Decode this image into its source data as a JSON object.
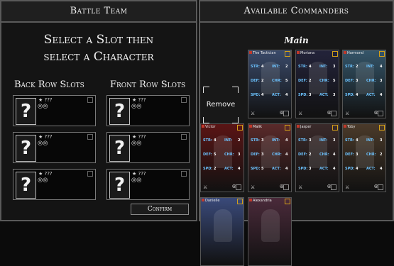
{
  "battle_team": {
    "title": "Battle Team",
    "instruction_line1": "Select a Slot then",
    "instruction_line2": "select a Character",
    "back_row_label": "Back Row Slots",
    "front_row_label": "Front Row Slots",
    "slot_placeholder": "?",
    "slot_stars": "★ ???",
    "slot_rank_icon": "three-circles-icon",
    "confirm_label": "Confirm"
  },
  "commanders": {
    "title": "Available Commanders",
    "section": "Main",
    "remove_label": "Remove",
    "cards": [
      {
        "name": "The Tactician",
        "color": "#3a4a6a",
        "str": "4",
        "int": "2",
        "def": "2",
        "chr": "5",
        "spd": "4",
        "act": "4"
      },
      {
        "name": "Moriana",
        "color": "#23233a",
        "str": "4",
        "int": "3",
        "def": "2",
        "chr": "5",
        "spd": "3",
        "act": "3"
      },
      {
        "name": "Harmond",
        "color": "#35566a",
        "str": "2",
        "int": "4",
        "def": "3",
        "chr": "3",
        "spd": "4",
        "act": "4"
      },
      {
        "name": "Victor",
        "color": "#5a1515",
        "str": "4",
        "int": "2",
        "def": "5",
        "chr": "3",
        "spd": "2",
        "act": "4"
      },
      {
        "name": "Malik",
        "color": "#5a2a2a",
        "str": "3",
        "int": "4",
        "def": "3",
        "chr": "4",
        "spd": "5",
        "act": "4"
      },
      {
        "name": "Jasper",
        "color": "#3a2a2a",
        "str": "3",
        "int": "3",
        "def": "2",
        "chr": "4",
        "spd": "3",
        "act": "4"
      },
      {
        "name": "Toby",
        "color": "#4a3a2a",
        "str": "4",
        "int": "3",
        "def": "3",
        "chr": "2",
        "spd": "4",
        "act": "4"
      },
      {
        "name": "Danielle",
        "color": "#3a4a7a",
        "str": "",
        "int": "",
        "def": "",
        "chr": "",
        "spd": "",
        "act": ""
      },
      {
        "name": "Alexandria",
        "color": "#4a2a3a",
        "str": "",
        "int": "",
        "def": "",
        "chr": "",
        "spd": "",
        "act": ""
      }
    ],
    "stat_labels": {
      "str": "STR:",
      "int": "INT:",
      "def": "DEF:",
      "chr": "CHR:",
      "spd": "SPD:",
      "act": "ACT:"
    }
  }
}
